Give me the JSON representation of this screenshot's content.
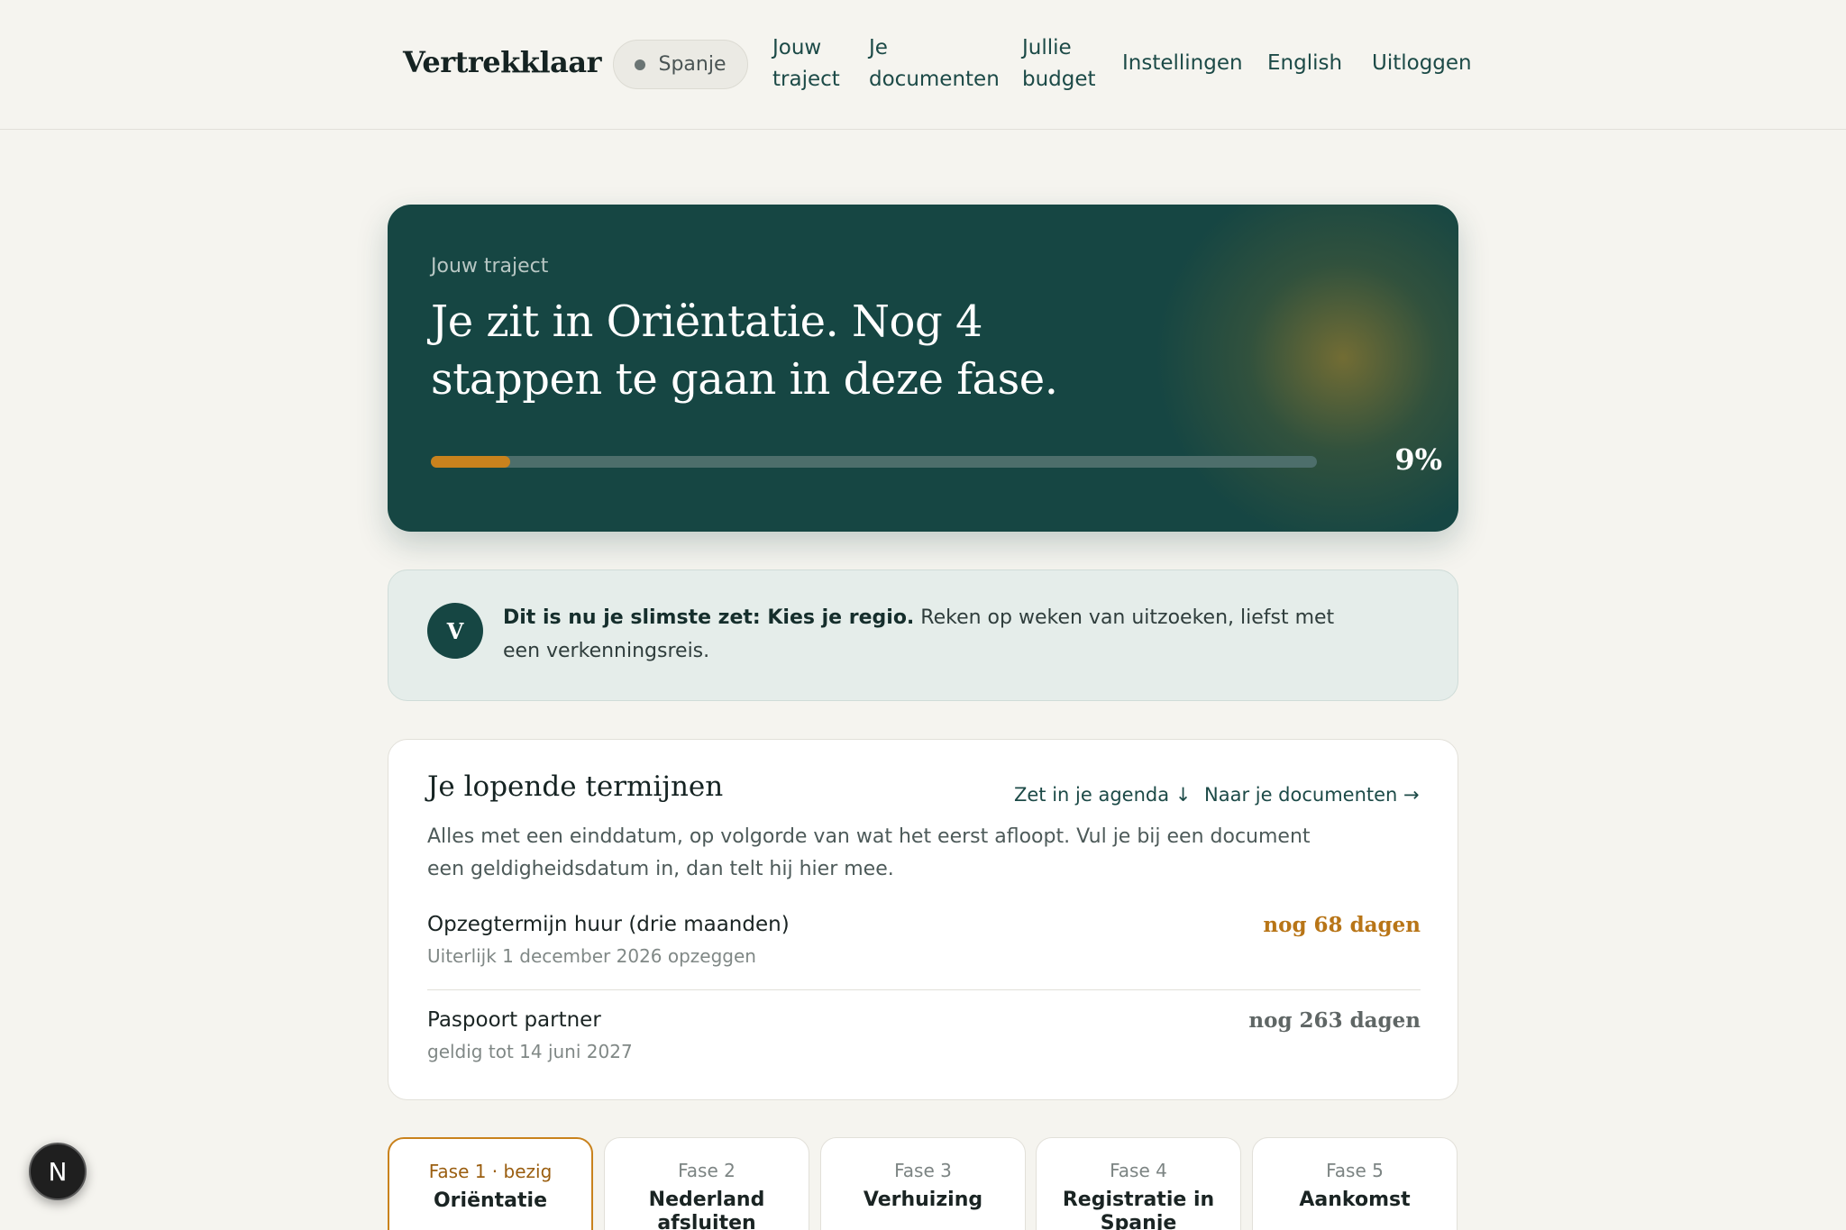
{
  "header": {
    "brand": "Vertrekklaar",
    "country": "Spanje",
    "nav": [
      {
        "label_line1": "Jouw",
        "label_line2": "traject"
      },
      {
        "label_line1": "Je",
        "label_line2": "documenten"
      },
      {
        "label_line1": "Jullie",
        "label_line2": "budget"
      },
      {
        "label_line1": "Instellingen"
      },
      {
        "label_line1": "English"
      },
      {
        "label_line1": "Uitloggen"
      }
    ]
  },
  "hero": {
    "eyebrow": "Jouw traject",
    "title": "Je zit in Oriëntatie. Nog 4 stappen te gaan in deze fase.",
    "progress_percent": 9,
    "progress_label": "9%"
  },
  "advice": {
    "avatar_letter": "V",
    "bold": "Dit is nu je slimste zet: Kies je regio.",
    "text": " Reken op weken van uitzoeken, liefst met een verkenningsreis."
  },
  "deadlines": {
    "title": "Je lopende termijnen",
    "agenda_link": "Zet in je agenda ↓",
    "documents_link": "Naar je documenten →",
    "description": "Alles met een einddatum, op volgorde van wat het eerst afloopt. Vul je bij een document een geldigheidsdatum in, dan telt hij hier mee.",
    "items": [
      {
        "name": "Opzegtermijn huur (drie maanden)",
        "sub": "Uiterlijk 1 december 2026 opzeggen",
        "days": "nog 68 dagen",
        "color": "#b87517"
      },
      {
        "name": "Paspoort partner",
        "sub": "geldig tot 14 juni 2027",
        "days": "nog 263 dagen",
        "color": "#5f6665"
      }
    ]
  },
  "phases": [
    {
      "label": "Fase 1 · bezig",
      "name": "Oriëntatie",
      "active": true
    },
    {
      "label": "Fase 2",
      "name": "Nederland afsluiten",
      "active": false
    },
    {
      "label": "Fase 3",
      "name": "Verhuizing",
      "active": false
    },
    {
      "label": "Fase 4",
      "name": "Registratie in Spanje",
      "active": false
    },
    {
      "label": "Fase 5",
      "name": "Aankomst",
      "active": false
    }
  ],
  "floating_button": {
    "letter": "N"
  },
  "colors": {
    "accent": "#c9821d",
    "primary": "#164643",
    "background": "#f5f4ef"
  }
}
